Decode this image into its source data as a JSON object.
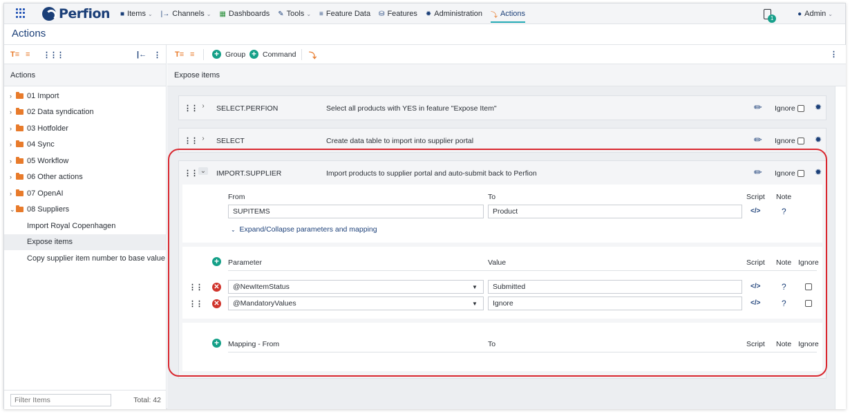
{
  "nav": {
    "logo": "Perfion",
    "items": [
      {
        "label": "Items",
        "icon": "cube-icon",
        "caret": true
      },
      {
        "label": "Channels",
        "icon": "channel-icon",
        "caret": true
      },
      {
        "label": "Dashboards",
        "icon": "dashboard-icon",
        "caret": false
      },
      {
        "label": "Tools",
        "icon": "wrench-icon",
        "caret": true
      },
      {
        "label": "Feature Data",
        "icon": "list-icon",
        "caret": false
      },
      {
        "label": "Features",
        "icon": "database-icon",
        "caret": false
      },
      {
        "label": "Administration",
        "icon": "gear-icon",
        "caret": false
      },
      {
        "label": "Actions",
        "icon": "bolt-icon",
        "caret": false,
        "active": true
      }
    ],
    "notification_count": "1",
    "user": "Admin"
  },
  "page_title": "Actions",
  "left": {
    "header": "Actions",
    "tree": [
      {
        "label": "01 Import",
        "type": "folder",
        "expanded": false
      },
      {
        "label": "02 Data syndication",
        "type": "folder",
        "expanded": false
      },
      {
        "label": "03 Hotfolder",
        "type": "folder",
        "expanded": false
      },
      {
        "label": "04 Sync",
        "type": "folder",
        "expanded": false
      },
      {
        "label": "05 Workflow",
        "type": "folder",
        "expanded": false
      },
      {
        "label": "06 Other actions",
        "type": "folder",
        "expanded": false
      },
      {
        "label": "07 OpenAI",
        "type": "folder",
        "expanded": false
      },
      {
        "label": "08 Suppliers",
        "type": "folder",
        "expanded": true
      },
      {
        "label": "Import Royal Copenhagen",
        "type": "leaf",
        "selected": false
      },
      {
        "label": "Expose items",
        "type": "leaf",
        "selected": true
      },
      {
        "label": "Copy supplier item number to base value",
        "type": "leaf",
        "selected": false
      }
    ],
    "filter_placeholder": "Filter Items",
    "total": "Total: 42"
  },
  "right": {
    "toolbar": {
      "group_label": "Group",
      "command_label": "Command"
    },
    "header": "Expose items",
    "commands": [
      {
        "name": "SELECT.PERFION",
        "description": "Select all products with YES in feature \"Expose Item\"",
        "ignore_label": "Ignore",
        "expanded": false
      },
      {
        "name": "SELECT",
        "description": "Create data table to import into supplier portal",
        "ignore_label": "Ignore",
        "expanded": false
      },
      {
        "name": "IMPORT.SUPPLIER",
        "description": "Import products to supplier portal and auto-submit back to Perfion",
        "ignore_label": "Ignore",
        "expanded": true
      }
    ],
    "import_supplier": {
      "from_label": "From",
      "to_label": "To",
      "script_label": "Script",
      "note_label": "Note",
      "ignore_label": "Ignore",
      "from_value": "SUPITEMS",
      "to_value": "Product",
      "expand_collapse_label": "Expand/Collapse parameters and mapping",
      "parameter_label": "Parameter",
      "value_label": "Value",
      "parameters": [
        {
          "name": "@NewItemStatus",
          "value": "Submitted"
        },
        {
          "name": "@MandatoryValues",
          "value": "Ignore"
        }
      ],
      "mapping_from_label": "Mapping - From",
      "mapping_to_label": "To"
    }
  }
}
